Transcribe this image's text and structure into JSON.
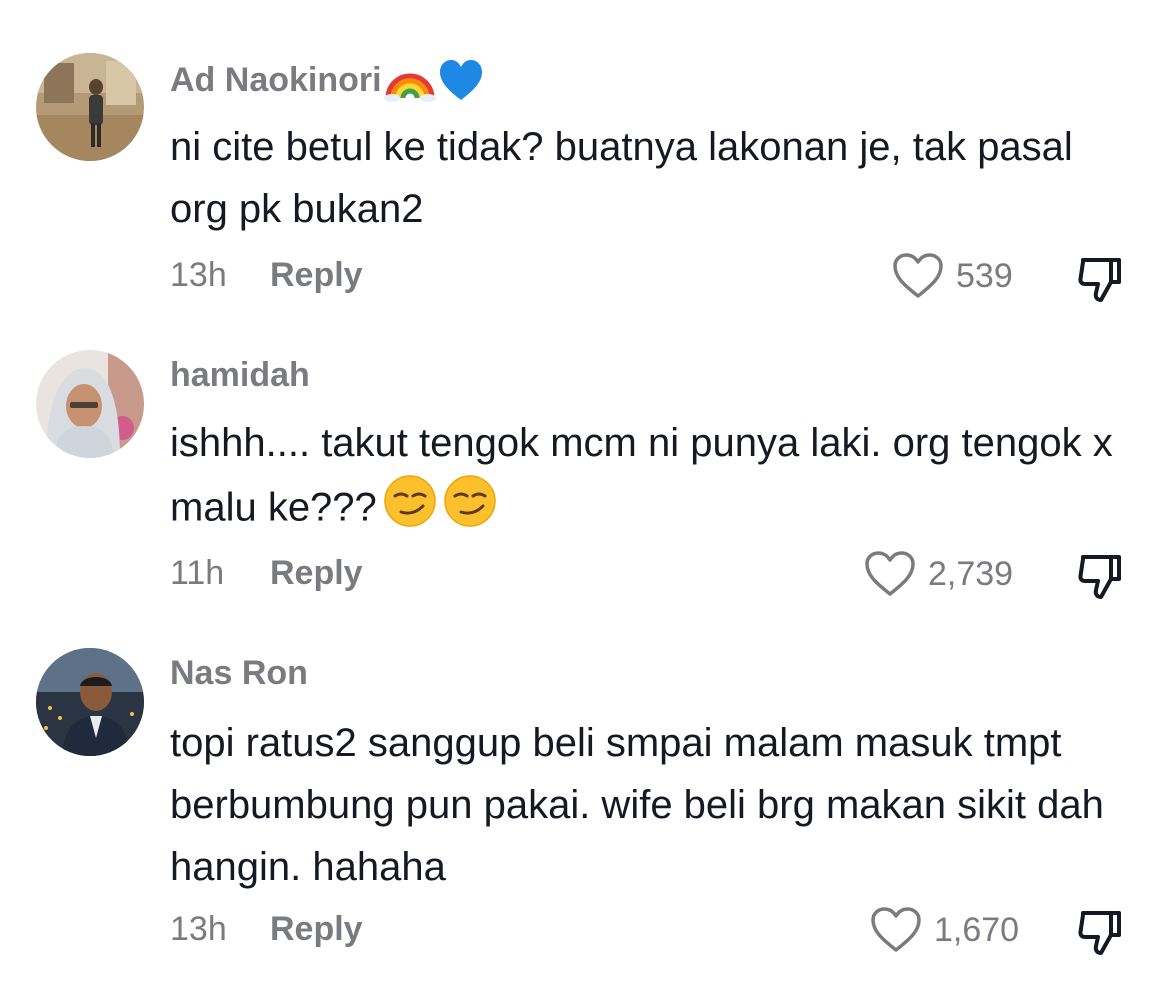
{
  "comments": [
    {
      "username": "Ad Naokinori",
      "badge_icons": [
        "rainbow-icon",
        "blue-heart-icon"
      ],
      "text": "ni cite betul ke tidak? buatnya lakonan je, tak pasal org pk bukan2",
      "time": "13h",
      "reply_label": "Reply",
      "likes": "539"
    },
    {
      "username": "hamidah",
      "text": "ishhh.... takut tengok mcm ni punya laki. org tengok x malu ke???",
      "text_emojis": [
        "smirk-emoji",
        "smirk-emoji"
      ],
      "time": "11h",
      "reply_label": "Reply",
      "likes": "2,739"
    },
    {
      "username": "Nas Ron",
      "text": "topi ratus2 sanggup beli smpai malam masuk tmpt berbumbung pun pakai. wife beli brg makan sikit dah hangin. hahaha",
      "time": "13h",
      "reply_label": "Reply",
      "likes": "1,670"
    }
  ],
  "colors": {
    "primary_text": "#161823",
    "secondary_text": "#7a7b80",
    "background": "#ffffff"
  }
}
